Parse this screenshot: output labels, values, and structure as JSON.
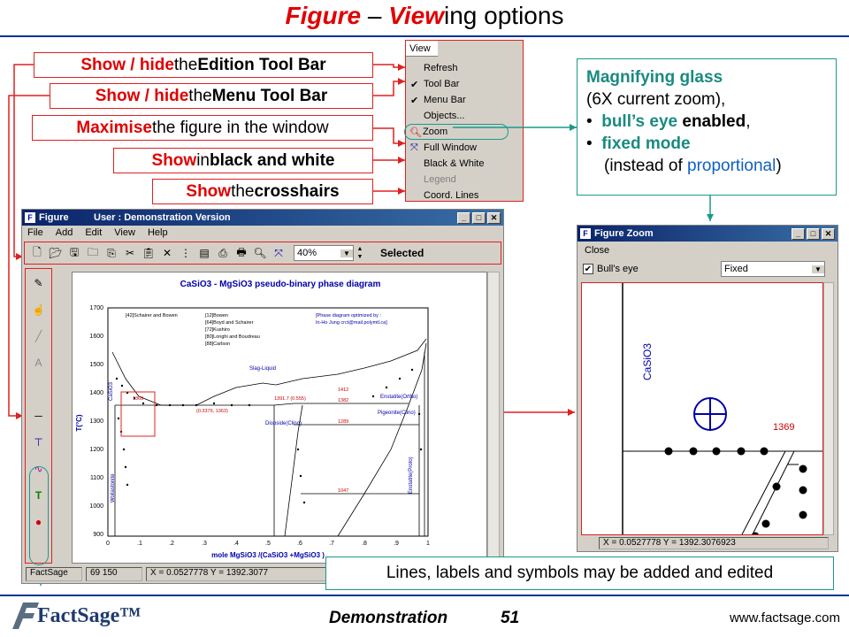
{
  "title": {
    "part1": "Figure",
    "part2": " – ",
    "part3": "View",
    "part4": "ing options"
  },
  "callouts": [
    {
      "bold": "Show / hide",
      "rest": " the ",
      "bold2": "Edition Tool Bar"
    },
    {
      "bold": "Show / hide",
      "rest": " the ",
      "bold2": "Menu Tool Bar"
    },
    {
      "bold": "Maximise",
      "rest": " the figure in the window",
      "bold2": ""
    },
    {
      "bold": "Show",
      "rest": " in ",
      "bold2": "black and white"
    },
    {
      "bold": "Show",
      "rest": " the ",
      "bold2": "crosshairs"
    }
  ],
  "view_menu": {
    "header": "View",
    "items": [
      {
        "label": "Refresh",
        "checked": ""
      },
      {
        "label": "Tool Bar",
        "checked": "✔"
      },
      {
        "label": "Menu Bar",
        "checked": "✔"
      },
      {
        "label": "Objects...",
        "checked": ""
      },
      {
        "label": "Zoom",
        "checked": ""
      },
      {
        "label": "Full Window",
        "checked": ""
      },
      {
        "label": "Black & White",
        "checked": ""
      },
      {
        "label": "Legend",
        "checked": ""
      },
      {
        "label": "Coord. Lines",
        "checked": ""
      }
    ]
  },
  "info": {
    "line1": "Magnifying glass",
    "line2": "(6X current zoom),",
    "b1a": "bull’s eye",
    "b1b": " enabled",
    "b1c": ",",
    "b2a": "fixed mode",
    "line5a": "(instead of ",
    "line5b": "proportional",
    "line5c": ")"
  },
  "figure_window": {
    "title": "Figure",
    "user": "User : Demonstration Version",
    "menus": [
      "File",
      "Add",
      "Edit",
      "View",
      "Help"
    ],
    "zoom": "40%",
    "selected": "Selected",
    "status_app": "FactSage",
    "status_pos": "69  150",
    "status_xy": "X = 0.0527778  Y = 1392.3077"
  },
  "plot": {
    "title": "CaSiO3 - MgSiO3 pseudo-binary phase diagram",
    "ylabel": "T(°C)",
    "xlabel": "mole MgSiO3 /(CaSiO3 +MgSiO3 )",
    "yticks": [
      "1700",
      "1600",
      "1500",
      "1400",
      "1300",
      "1200",
      "1100",
      "1000",
      "900"
    ],
    "xticks": [
      "0",
      ".1",
      ".2",
      ".3",
      ".4",
      ".5",
      ".6",
      ".7",
      ".8",
      ".9",
      "1"
    ],
    "legend1": [
      "[42]Schairer and Bowen"
    ],
    "legend2": [
      "[12]Bowen",
      "[64]Boyd and Schairer",
      "[72]Kushiro",
      "[80]Longhi and Boudreau",
      "[88]Carlson"
    ],
    "note1": "[Phase diagram optimized by :",
    "note2": "In-Ho Jung  crct@mail.polymtl.ca]",
    "labels": {
      "slag": "Slag-Liquid",
      "diopside": "Diopside(Clino)",
      "pigeonite": "Pigeonite(Clino)",
      "enstatite": "Enstatite(Ortho)",
      "protoen": "Enstatite(Proto)",
      "wollastonite": "Wollastonite",
      "casio3": "CaSiO3",
      "t1": "1391.7 (0.555)",
      "t2": "1412",
      "t3": "1382",
      "t4": "1289",
      "t5": "1047",
      "t6": "(0.3376, 1363)",
      "t7": "1369"
    }
  },
  "zoom_window": {
    "title": "Figure Zoom",
    "menu": "Close",
    "bulls_eye": "Bull's eye",
    "mode": "Fixed",
    "label_casio3": "CaSiO3",
    "label_1369": "1369",
    "status": "X = 0.0527778  Y = 1392.3076923"
  },
  "bottom_note": "Lines, labels and symbols may be added and edited",
  "footer": {
    "demo": "Demonstration",
    "page": "51",
    "url": "www.factsage.com",
    "logo": "FactSage™"
  }
}
